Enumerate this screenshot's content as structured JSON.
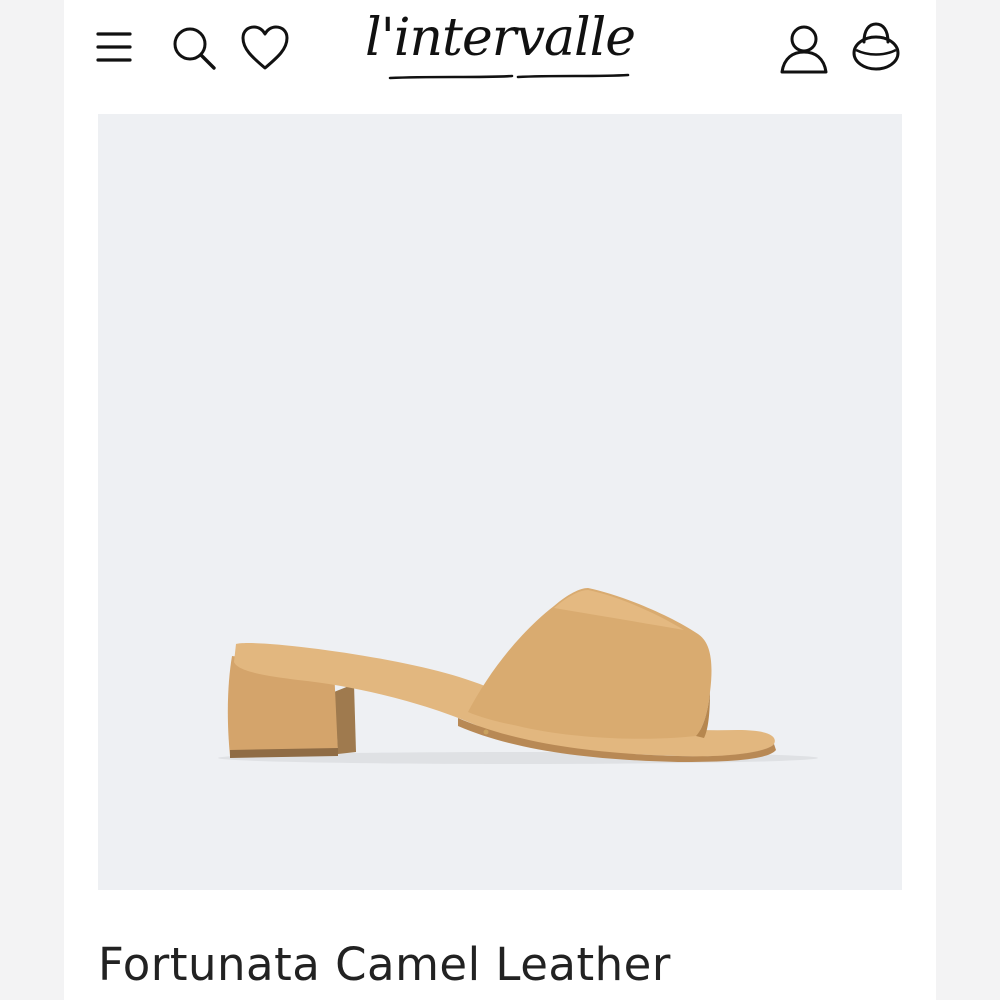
{
  "header": {
    "brand_name": "l'intervalle",
    "icons": {
      "menu": "hamburger-menu-icon",
      "search": "search-icon",
      "wishlist": "heart-icon",
      "account": "user-icon",
      "bag": "shopping-bag-icon"
    }
  },
  "product": {
    "title": "Fortunata Camel Leather",
    "image_alt": "sandal-image",
    "colors": {
      "background": "#eef0f3",
      "leather": "#d9ab70"
    }
  }
}
